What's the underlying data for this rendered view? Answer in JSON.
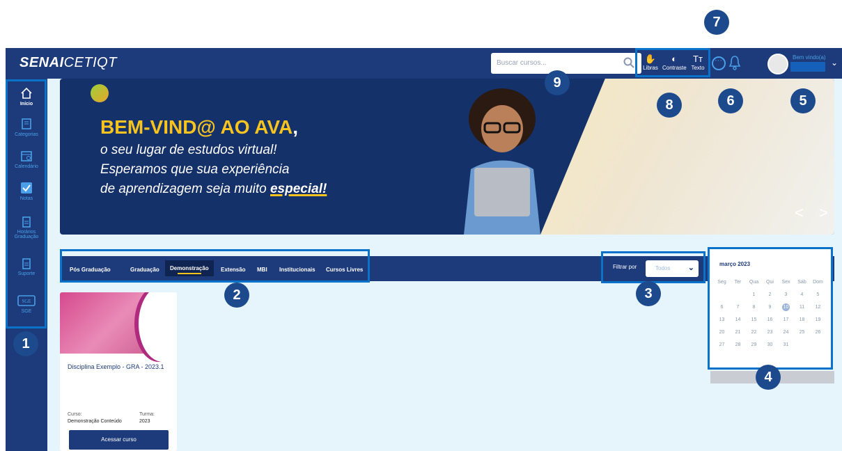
{
  "header": {
    "brand_bold": "SENAI",
    "brand_light": "CETIQT",
    "search_placeholder": "Buscar cursos...",
    "a11y": [
      {
        "label": "Libras",
        "glyph": "✋"
      },
      {
        "label": "Contraste",
        "glyph": "◐"
      },
      {
        "label": "Texto",
        "glyph": "Tт"
      }
    ],
    "welcome": "Bem vindo(a)"
  },
  "sidebar": {
    "items": [
      {
        "label": "Início",
        "icon": "home-icon"
      },
      {
        "label": "Categorias",
        "icon": "book-icon"
      },
      {
        "label": "Calendário",
        "icon": "calendar-icon"
      },
      {
        "label": "Notas",
        "icon": "check-icon"
      },
      {
        "label": "Horários Graduação",
        "icon": "document-icon"
      },
      {
        "label": "Suporte",
        "icon": "document-icon"
      },
      {
        "label": "SGE",
        "icon": "sge-icon"
      }
    ]
  },
  "banner": {
    "headline_a": "BEM-VIND@ AO AVA",
    "headline_b": ",",
    "line1": "o seu lugar de estudos virtual!",
    "line2": "Esperamos que sua experiência",
    "line3": "de aprendizagem seja muito ",
    "line3_emph": "especial!",
    "nav": "< >"
  },
  "tabs": [
    {
      "label": "Pós Graduação"
    },
    {
      "label": "Graduação"
    },
    {
      "label": "Demonstração"
    },
    {
      "label": "Extensão"
    },
    {
      "label": "MBI"
    },
    {
      "label": "Institucionais"
    },
    {
      "label": "Cursos Livres"
    }
  ],
  "filter": {
    "label": "Filtrar por",
    "value": "Todos"
  },
  "calendar": {
    "title": "março 2023",
    "weekdays": [
      "Seg",
      "Ter",
      "Qua",
      "Qui",
      "Sex",
      "Sáb",
      "Dom"
    ],
    "weeks": [
      [
        "",
        "",
        "1",
        "2",
        "3",
        "4",
        "5"
      ],
      [
        "6",
        "7",
        "8",
        "9",
        "10",
        "11",
        "12"
      ],
      [
        "13",
        "14",
        "15",
        "16",
        "17",
        "18",
        "19"
      ],
      [
        "20",
        "21",
        "22",
        "23",
        "24",
        "25",
        "26"
      ],
      [
        "27",
        "28",
        "29",
        "30",
        "31",
        "",
        ""
      ]
    ],
    "today": "10"
  },
  "course": {
    "title": "Disciplina Exemplo - GRA - 2023.1",
    "curso_label": "Curso:",
    "curso_value": "Demonstração Conteúdo",
    "turma_label": "Turma:",
    "turma_value": "2023",
    "button": "Acessar curso"
  },
  "markers": [
    "1",
    "2",
    "3",
    "4",
    "5",
    "6",
    "7",
    "8",
    "9"
  ]
}
